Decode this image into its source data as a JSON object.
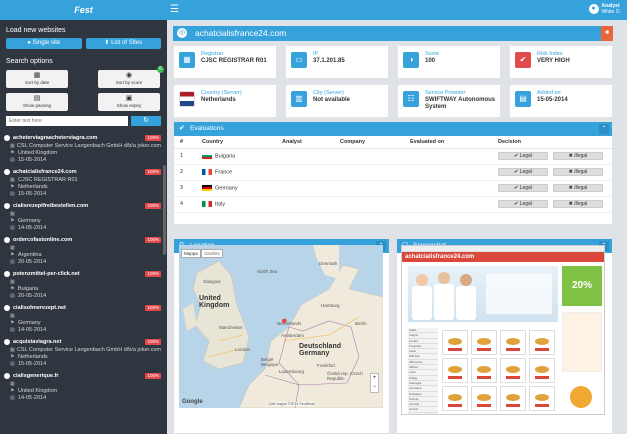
{
  "sidebar": {
    "brand": "Fest",
    "load_title": "Load new websites",
    "single_label": "Single site",
    "list_label": "List of Sites",
    "search_title": "Search options",
    "opts": [
      {
        "label": "Sort by date",
        "icon": "calendar-icon"
      },
      {
        "label": "Sort by score",
        "icon": "gauge-icon"
      },
      {
        "label": "Show passing",
        "icon": "lock-open-icon"
      },
      {
        "label": "Show expiry",
        "icon": "lock-icon"
      }
    ],
    "filter_badge": "6",
    "search_placeholder": "Enter text here",
    "sites": [
      {
        "name": "acheterviagraacheterviagra.com",
        "risk": "100%",
        "reg": "CSL Computer Service Langenbach GmbH d/b/a joker.com",
        "country": "United Kingdom",
        "date": "15-05-2014"
      },
      {
        "name": "achatcialisfrance24.com",
        "risk": "100%",
        "reg": "CJSC REGISTRAR R01",
        "country": "Netherlands",
        "date": "15-05-2014"
      },
      {
        "name": "cialisrezeptfreibestellen.com",
        "risk": "100%",
        "reg": "",
        "country": "Germany",
        "date": "14-05-2014"
      },
      {
        "name": "ordercofastonline.com",
        "risk": "100%",
        "reg": "",
        "country": "Argentina",
        "date": "20-05-2014"
      },
      {
        "name": "potenzmittel-per-click.net",
        "risk": "100%",
        "reg": "",
        "country": "Bulgaria",
        "date": "20-05-2014"
      },
      {
        "name": "cialisohnerezept.net",
        "risk": "100%",
        "reg": "",
        "country": "Germany",
        "date": "14-05-2014"
      },
      {
        "name": "acquistaviagra.net",
        "risk": "100%",
        "reg": "CSL Computer Service Langenbach GmbH d/b/a joker.com",
        "country": "Netherlands",
        "date": "15-05-2014"
      },
      {
        "name": "cialisgenerique.fr",
        "risk": "100%",
        "reg": "",
        "country": "United Kingdom",
        "date": "14-05-2014"
      }
    ]
  },
  "topbar": {
    "user_name": "Analyst",
    "user_sub": "White O."
  },
  "site": {
    "title": "achatcialisfrance24.com"
  },
  "cards": [
    {
      "label": "Registrar",
      "value": "CJSC REGISTRAR R01",
      "icon": "building-icon",
      "color": "#35a2dc"
    },
    {
      "label": "IP",
      "value": "37.1.201.85",
      "icon": "laptop-icon",
      "color": "#35a2dc"
    },
    {
      "label": "Score",
      "value": "100",
      "icon": "gauge-icon",
      "color": "#35a2dc"
    },
    {
      "label": "Risk Index",
      "value": "VERY HIGH",
      "icon": "check-icon",
      "color": "#e04a4a"
    },
    {
      "label": "Country (Server)",
      "value": "Netherlands",
      "icon": "flag-icon",
      "color": "#ffffff"
    },
    {
      "label": "City (Server)",
      "value": "Not available",
      "icon": "city-icon",
      "color": "#35a2dc"
    },
    {
      "label": "Service Provider",
      "value": "SWIFTWAY Autonomous System",
      "icon": "network-icon",
      "color": "#35a2dc"
    },
    {
      "label": "Added on",
      "value": "15-05-2014",
      "icon": "calendar-icon",
      "color": "#35a2dc"
    }
  ],
  "evaluations": {
    "title": "Evaluations",
    "cols": [
      "#",
      "Country",
      "Analyst",
      "Company",
      "Evaluated on",
      "Decision"
    ],
    "rows": [
      {
        "n": "1",
        "country": "Bulgaria"
      },
      {
        "n": "2",
        "country": "France"
      },
      {
        "n": "3",
        "country": "Germany"
      },
      {
        "n": "4",
        "country": "Italy"
      }
    ],
    "legal": "✔ Legal",
    "illegal": "✖ Illegal"
  },
  "location": {
    "title": "Location",
    "map_tab": "Mappa",
    "sat_tab": "Satellite",
    "places": {
      "uk": "United Kingdom",
      "nl": "Netherlands",
      "de": "Deutschland Germany",
      "be": "België Belgique",
      "lux": "Luxembourg",
      "cz": "Česká rep. Czech Republic",
      "north": "North Sea",
      "den": "Denmark",
      "ham": "Hamburg",
      "gl": "Glasgow",
      "lon": "London",
      "man": "Manchester",
      "frank": "Frankfurt",
      "ams": "Amsterdam",
      "ber": "Berlin"
    },
    "google": "Google",
    "footer": "Dati mappa ©2014 GeoBasis"
  },
  "screenshot": {
    "title": "Screenshot",
    "page_title": "achatcialisfrance24.com",
    "promo": "20%",
    "cats": [
      "Cialis",
      "Viagra",
      "Levitra",
      "Propecia",
      "Lasix",
      "Diflucan",
      "Zithromax",
      "Valtrex",
      "Cipro",
      "Priligy",
      "Kamagra",
      "Accutane",
      "Nolvadex",
      "Clomid",
      "Xenical",
      "Amoxil",
      "Zoloft",
      "Prozac"
    ]
  }
}
